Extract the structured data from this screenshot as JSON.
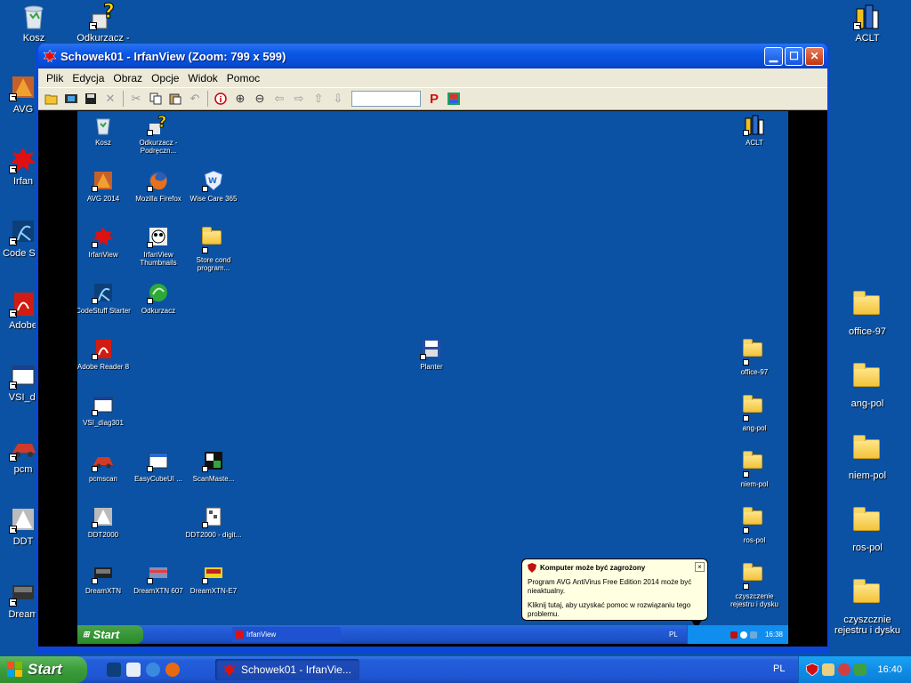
{
  "desktop": {
    "left_icons": [
      {
        "label": "Kosz",
        "icon": "recycle-bin-icon"
      },
      {
        "label": "AVG",
        "icon": "avg-icon"
      },
      {
        "label": "Irfan",
        "icon": "irfanview-icon"
      },
      {
        "label": "Code Sta",
        "icon": "codestuff-icon"
      },
      {
        "label": "Adobe",
        "icon": "adobe-reader-icon"
      },
      {
        "label": "VSI_di",
        "icon": "vsi-icon"
      },
      {
        "label": "pcm",
        "icon": "pcmscan-icon"
      },
      {
        "label": "DDT",
        "icon": "ddt-icon"
      },
      {
        "label": "Dream",
        "icon": "dream-icon"
      }
    ],
    "top_icon": {
      "label": "Odkurzacz -",
      "icon": "cleaner-icon"
    },
    "right_icons": [
      {
        "label": "ACLT",
        "icon": "aclt-icon"
      },
      {
        "label": "office-97",
        "icon": "folder-icon"
      },
      {
        "label": "ang-pol",
        "icon": "folder-icon"
      },
      {
        "label": "niem-pol",
        "icon": "folder-icon"
      },
      {
        "label": "ros-pol",
        "icon": "folder-icon"
      },
      {
        "label": "czyszcznie rejestru i dysku",
        "icon": "folder-icon"
      }
    ]
  },
  "window": {
    "title": "Schowek01 - IrfanView (Zoom: 799 x 599)",
    "menu": [
      "Plik",
      "Edycja",
      "Obraz",
      "Opcje",
      "Widok",
      "Pomoc"
    ],
    "zoom_value": ""
  },
  "inner": {
    "icons": [
      {
        "label": "Kosz",
        "kind": "recycle"
      },
      {
        "label": "Odkurzacz - Podręczn...",
        "kind": "cleaner"
      },
      {
        "label": "ACLT",
        "kind": "aclt"
      },
      {
        "label": "AVG 2014",
        "kind": "avg"
      },
      {
        "label": "Mozilla Firefox",
        "kind": "firefox"
      },
      {
        "label": "Wise Care 365",
        "kind": "wise"
      },
      {
        "label": "IrfanView",
        "kind": "irfan"
      },
      {
        "label": "IrfanView Thumbnails",
        "kind": "thumbs"
      },
      {
        "label": "Store cond program...",
        "kind": "folder"
      },
      {
        "label": "CodeStuff Starter",
        "kind": "codestuff"
      },
      {
        "label": "Odkurzacz",
        "kind": "odkurzacz"
      },
      {
        "label": "Adobe Reader 8",
        "kind": "adobe"
      },
      {
        "label": "Planter",
        "kind": "floppy"
      },
      {
        "label": "office-97",
        "kind": "folder"
      },
      {
        "label": "VSI_diag301",
        "kind": "vsi"
      },
      {
        "label": "ang-pol",
        "kind": "folder"
      },
      {
        "label": "pcmscan",
        "kind": "pcm"
      },
      {
        "label": "EasyCubeUI ...",
        "kind": "easycube"
      },
      {
        "label": "ScanMaste...",
        "kind": "scanmaster"
      },
      {
        "label": "niem-pol",
        "kind": "folder"
      },
      {
        "label": "DDT2000",
        "kind": "ddt"
      },
      {
        "label": "DDT2000 - digit...",
        "kind": "ddt2"
      },
      {
        "label": "ros-pol",
        "kind": "folder"
      },
      {
        "label": "DreamXTN",
        "kind": "dream"
      },
      {
        "label": "DreamXTN 607",
        "kind": "dream2"
      },
      {
        "label": "DreamXTN-E7",
        "kind": "dream3"
      },
      {
        "label": "czyszczenie rejestru i dysku",
        "kind": "folder"
      }
    ],
    "balloon": {
      "title": "Komputer może być zagrożony",
      "line1": "Program AVG AntiVirus Free Edition 2014 może być nieaktualny.",
      "line2": "Kliknij tutaj, aby uzyskać pomoc w rozwiązaniu tego problemu."
    },
    "start_label": "Start",
    "task_label": "IrfanView",
    "lang": "PL",
    "clock": "16:38"
  },
  "taskbar": {
    "start_label": "Start",
    "task_label": "Schowek01 - IrfanVie...",
    "lang": "PL",
    "clock": "16:40"
  }
}
